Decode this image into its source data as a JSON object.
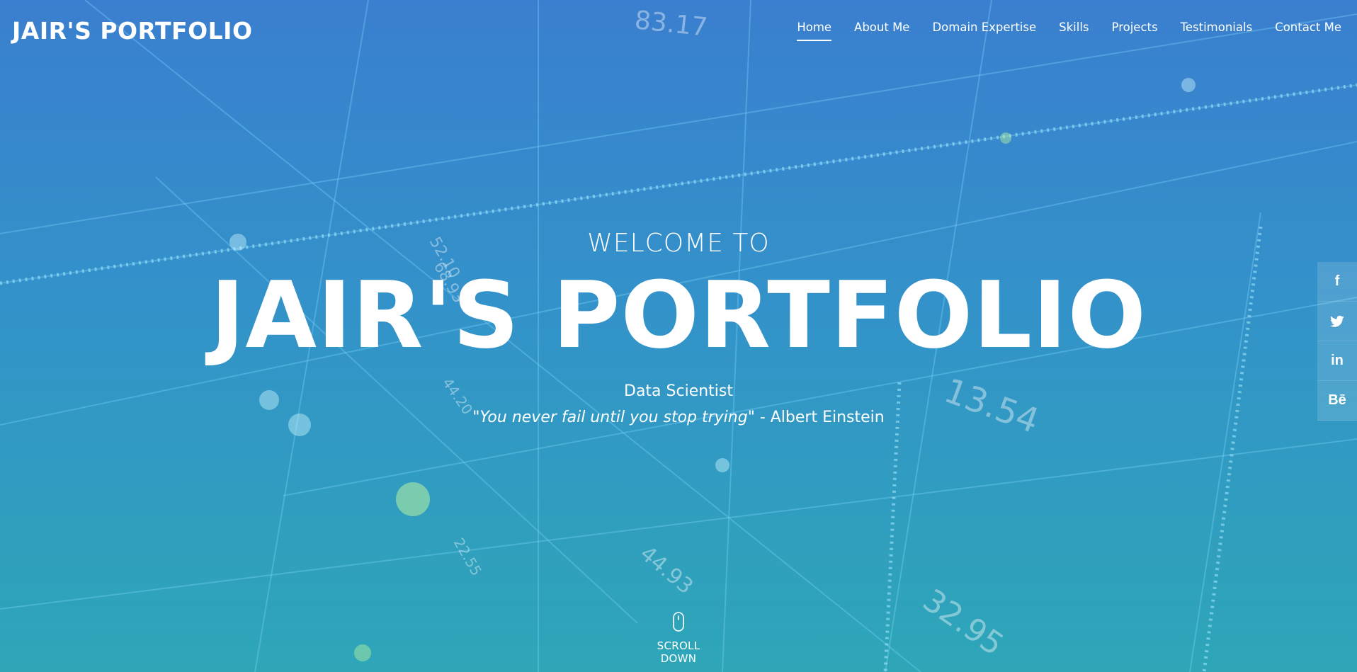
{
  "site": {
    "logo": "JAIR'S PORTFOLIO"
  },
  "nav": {
    "items": [
      {
        "label": "Home",
        "active": true
      },
      {
        "label": "About Me"
      },
      {
        "label": "Domain Expertise"
      },
      {
        "label": "Skills"
      },
      {
        "label": "Projects"
      },
      {
        "label": "Testimonials"
      },
      {
        "label": "Contact Me"
      }
    ]
  },
  "hero": {
    "welcome": "WELCOME TO",
    "title": "JAIR'S PORTFOLIO",
    "role": "Data Scientist",
    "quote": "\"You never fail until you stop trying\"",
    "quote_author": " - Albert Einstein",
    "scroll_label": "SCROLL DOWN"
  },
  "background_numbers": [
    "83.17",
    "52.10",
    "68.93",
    "44.20",
    "13.54",
    "44.93",
    "32.95",
    "22.55"
  ],
  "social": [
    {
      "name": "facebook",
      "glyph": "f"
    },
    {
      "name": "twitter",
      "glyph": "🐦"
    },
    {
      "name": "linkedin",
      "glyph": "in"
    },
    {
      "name": "behance",
      "glyph": "Bē"
    }
  ],
  "colors": {
    "gradient_top": "#3a7fcf",
    "gradient_bottom": "#2ea6b8",
    "text": "#ffffff"
  }
}
